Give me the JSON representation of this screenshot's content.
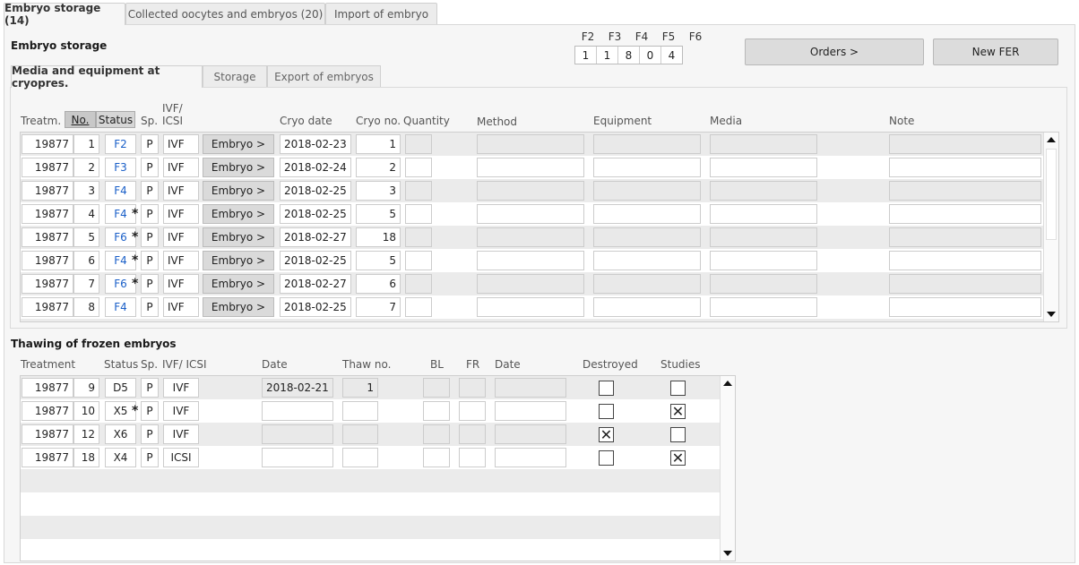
{
  "tabs": [
    "Embryo storage (14)",
    "Collected oocytes and embryos (20)",
    "Import of embryo"
  ],
  "storage": {
    "title": "Embryo storage",
    "f_headers": [
      "F2",
      "F3",
      "F4",
      "F5",
      "F6"
    ],
    "f_values": [
      "1",
      "1",
      "8",
      "0",
      "4"
    ],
    "orders_label": "Orders >",
    "new_fer_label": "New FER",
    "subtabs": [
      "Media and equipment at cryopres.",
      "Storage",
      "Export of embryos"
    ],
    "columns": {
      "treatm": "Treatm.",
      "no": "No.",
      "status": "Status",
      "sp": "Sp.",
      "ivf_line1": "IVF/",
      "ivf_line2": "ICSI",
      "cryo_date": "Cryo date",
      "cryo_no": "Cryo no.",
      "quantity": "Quantity",
      "method": "Method",
      "equipment": "Equipment",
      "media": "Media",
      "note": "Note"
    },
    "embryo_button_label": "Embryo >",
    "rows": [
      {
        "treatm": "19877",
        "no": "1",
        "status": "F2",
        "star": "",
        "sp": "P",
        "ivf": "IVF",
        "cryo_date": "2018-02-23",
        "cryo_no": "1"
      },
      {
        "treatm": "19877",
        "no": "2",
        "status": "F3",
        "star": "",
        "sp": "P",
        "ivf": "IVF",
        "cryo_date": "2018-02-24",
        "cryo_no": "2"
      },
      {
        "treatm": "19877",
        "no": "3",
        "status": "F4",
        "star": "",
        "sp": "P",
        "ivf": "IVF",
        "cryo_date": "2018-02-25",
        "cryo_no": "3"
      },
      {
        "treatm": "19877",
        "no": "4",
        "status": "F4",
        "star": "*",
        "sp": "P",
        "ivf": "IVF",
        "cryo_date": "2018-02-25",
        "cryo_no": "5"
      },
      {
        "treatm": "19877",
        "no": "5",
        "status": "F6",
        "star": "*",
        "sp": "P",
        "ivf": "IVF",
        "cryo_date": "2018-02-27",
        "cryo_no": "18"
      },
      {
        "treatm": "19877",
        "no": "6",
        "status": "F4",
        "star": "*",
        "sp": "P",
        "ivf": "IVF",
        "cryo_date": "2018-02-25",
        "cryo_no": "5"
      },
      {
        "treatm": "19877",
        "no": "7",
        "status": "F6",
        "star": "*",
        "sp": "P",
        "ivf": "IVF",
        "cryo_date": "2018-02-27",
        "cryo_no": "6"
      },
      {
        "treatm": "19877",
        "no": "8",
        "status": "F4",
        "star": "",
        "sp": "P",
        "ivf": "IVF",
        "cryo_date": "2018-02-25",
        "cryo_no": "7"
      }
    ]
  },
  "thawing": {
    "title": "Thawing of frozen embryos",
    "columns": {
      "treatment": "Treatment",
      "status": "Status",
      "sp": "Sp.",
      "ivf": "IVF/ ICSI",
      "date": "Date",
      "thaw_no": "Thaw no.",
      "bl": "BL",
      "fr": "FR",
      "date2": "Date",
      "destroyed": "Destroyed",
      "studies": "Studies"
    },
    "rows": [
      {
        "treatm": "19877",
        "no": "9",
        "status": "D5",
        "star": "",
        "sp": "P",
        "ivf": "IVF",
        "date": "2018-02-21",
        "thaw_no": "1",
        "destroyed": "",
        "studies": ""
      },
      {
        "treatm": "19877",
        "no": "10",
        "status": "X5",
        "star": "*",
        "sp": "P",
        "ivf": "IVF",
        "date": "",
        "thaw_no": "",
        "destroyed": "",
        "studies": "✕"
      },
      {
        "treatm": "19877",
        "no": "12",
        "status": "X6",
        "star": "",
        "sp": "P",
        "ivf": "IVF",
        "date": "",
        "thaw_no": "",
        "destroyed": "✕",
        "studies": ""
      },
      {
        "treatm": "19877",
        "no": "18",
        "status": "X4",
        "star": "",
        "sp": "P",
        "ivf": "ICSI",
        "date": "",
        "thaw_no": "",
        "destroyed": "",
        "studies": "✕"
      }
    ]
  },
  "colors": {
    "link": "#1a5fc8",
    "panel_bg": "#f6f6f6",
    "row_alt": "#ebebeb"
  }
}
